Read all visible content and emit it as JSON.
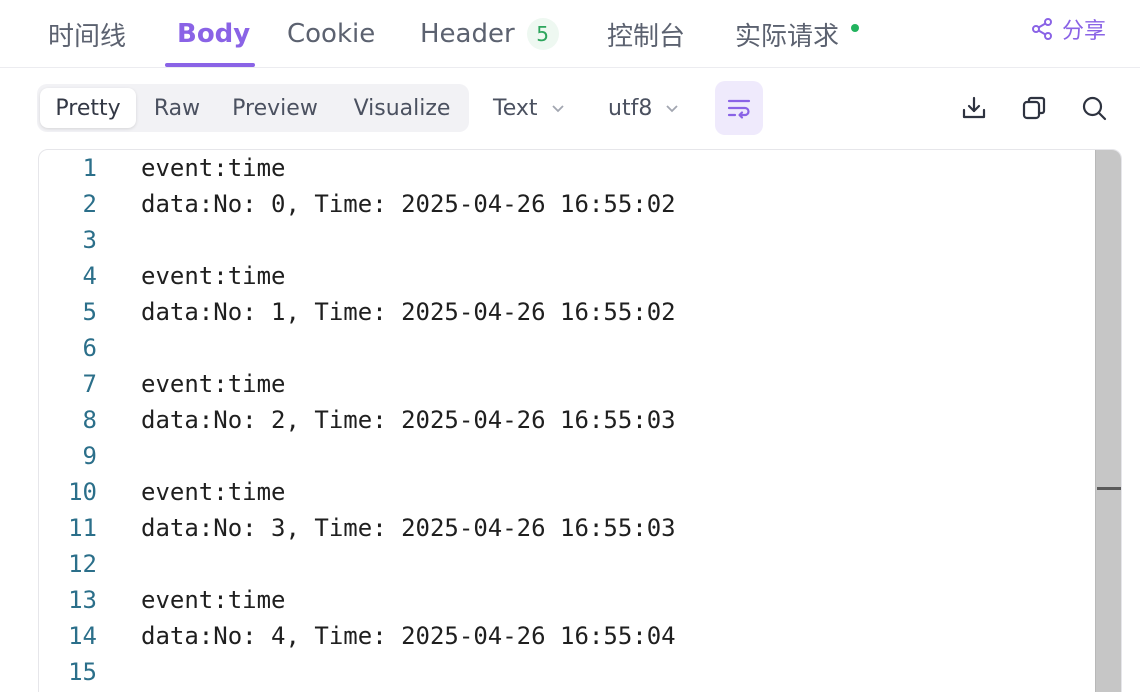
{
  "tabs": [
    {
      "label": "时间线"
    },
    {
      "label": "Body"
    },
    {
      "label": "Cookie"
    },
    {
      "label": "Header",
      "badge": "5"
    },
    {
      "label": "控制台"
    },
    {
      "label": "实际请求"
    }
  ],
  "active_tab": "Body",
  "share_label": "分享",
  "view_modes": [
    "Pretty",
    "Raw",
    "Preview",
    "Visualize"
  ],
  "active_view_mode": "Pretty",
  "format_select": {
    "value": "Text"
  },
  "encoding_select": {
    "value": "utf8"
  },
  "toolbar_icons": [
    "wrap-lines-icon",
    "download-icon",
    "copy-icon",
    "search-icon"
  ],
  "colors": {
    "accent": "#8a63e6",
    "badge_green": "#2da55c",
    "line_number": "#2b6f8a"
  },
  "editor": {
    "lines": [
      {
        "n": "1",
        "text": "event:time"
      },
      {
        "n": "2",
        "text": "data:No: 0, Time: 2025-04-26 16:55:02"
      },
      {
        "n": "3",
        "text": ""
      },
      {
        "n": "4",
        "text": "event:time"
      },
      {
        "n": "5",
        "text": "data:No: 1, Time: 2025-04-26 16:55:02"
      },
      {
        "n": "6",
        "text": ""
      },
      {
        "n": "7",
        "text": "event:time"
      },
      {
        "n": "8",
        "text": "data:No: 2, Time: 2025-04-26 16:55:03"
      },
      {
        "n": "9",
        "text": ""
      },
      {
        "n": "10",
        "text": "event:time"
      },
      {
        "n": "11",
        "text": "data:No: 3, Time: 2025-04-26 16:55:03"
      },
      {
        "n": "12",
        "text": ""
      },
      {
        "n": "13",
        "text": "event:time"
      },
      {
        "n": "14",
        "text": "data:No: 4, Time: 2025-04-26 16:55:04"
      },
      {
        "n": "15",
        "text": ""
      }
    ]
  }
}
